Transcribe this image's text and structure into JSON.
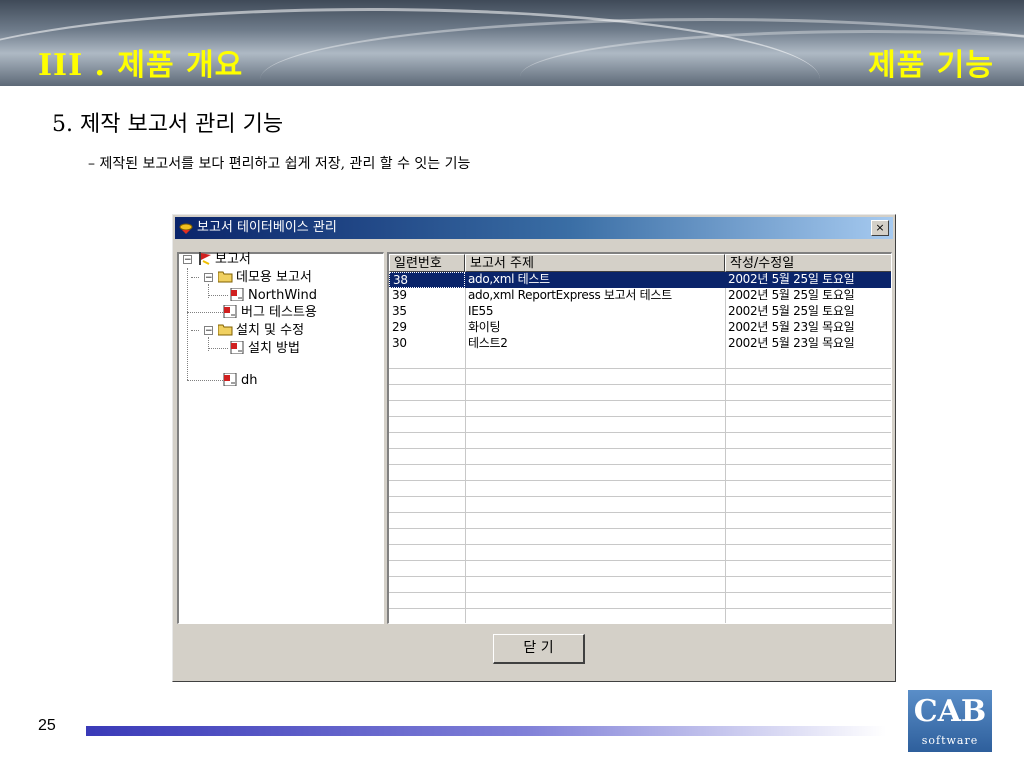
{
  "slide": {
    "left_title": "III . 제품 개요",
    "right_title": "제품 기능",
    "heading": "5. 제작 보고서 관리 기능",
    "subheading": "– 제작된 보고서를 보다 편리하고 쉽게 저장, 관리 할 수 잇는 기능",
    "page_number": "25",
    "logo_text": "CAB",
    "logo_sub": "software"
  },
  "dialog": {
    "title": "보고서 테이터베이스 관리",
    "close_label": "×",
    "tree": [
      {
        "label": "보고서",
        "icon": "red-flag-icon",
        "level": 0
      },
      {
        "label": "데모용 보고서",
        "icon": "folder-icon",
        "level": 1
      },
      {
        "label": "NorthWind",
        "icon": "report-icon",
        "level": 2
      },
      {
        "label": "버그 테스트용",
        "icon": "report-icon",
        "level": 1
      },
      {
        "label": "설치 및 수정",
        "icon": "folder-icon",
        "level": 1
      },
      {
        "label": "설치 방법",
        "icon": "report-icon",
        "level": 2
      },
      {
        "label": "dh",
        "icon": "report-icon",
        "level": 1
      }
    ],
    "columns": [
      "일련번호",
      "보고서 주제",
      "작성/수정일"
    ],
    "rows": [
      [
        "38",
        "ado,xml 테스트",
        "2002년 5월 25일 토요일"
      ],
      [
        "39",
        "ado,xml ReportExpress 보고서 테스트",
        "2002년 5월 25일 토요일"
      ],
      [
        "35",
        "IE55",
        "2002년 5월 25일 토요일"
      ],
      [
        "29",
        "화이팅",
        "2002년 5월 23일 목요일"
      ],
      [
        "30",
        "테스트2",
        "2002년 5월 23일 목요일"
      ]
    ],
    "selected_row": 0,
    "close_button_label": "닫 기"
  },
  "colors": {
    "title_yellow": "#ffff00",
    "selection": "#0a246a",
    "window_face": "#d4d0c8"
  }
}
